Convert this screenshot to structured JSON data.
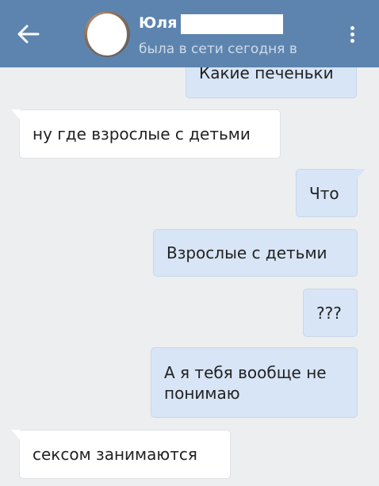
{
  "header": {
    "back_icon": "arrow-left-icon",
    "contact_name": "Юля",
    "status": "была в сети сегодня в",
    "menu_icon": "more-vertical-icon",
    "colors": {
      "background": "#5d84ae",
      "title": "#ffffff",
      "status": "#cfdbe8"
    }
  },
  "messages": [
    {
      "direction": "outgoing",
      "text": "Какие печеньки"
    },
    {
      "direction": "incoming",
      "text": "ну где взрослые с детьми"
    },
    {
      "direction": "outgoing",
      "text": "Что"
    },
    {
      "direction": "outgoing",
      "text": "Взрослые с детьми"
    },
    {
      "direction": "outgoing",
      "text": "???"
    },
    {
      "direction": "outgoing",
      "text": "А я тебя вообще не понимаю"
    },
    {
      "direction": "incoming",
      "text": "сексом занимаются"
    }
  ],
  "colors": {
    "chat_background": "#edeef0",
    "outgoing_bubble": "#d7e5f6",
    "incoming_bubble": "#ffffff",
    "text": "#222222"
  }
}
